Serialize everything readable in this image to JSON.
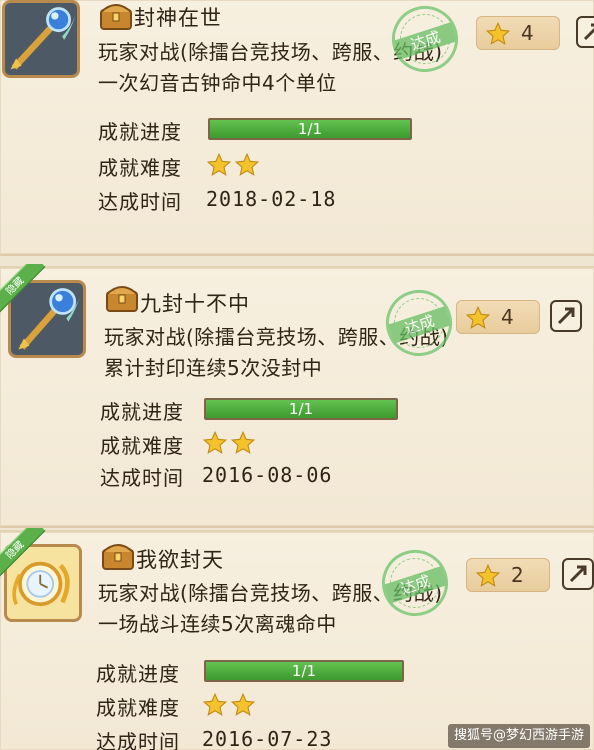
{
  "achievements": [
    {
      "ribbon": "",
      "title": "封神在世",
      "description": "玩家对战(除擂台竞技场、跨服、约战)一次幻音古钟命中4个单位",
      "stamp": "达成",
      "stars": "4",
      "progress_label": "成就进度",
      "progress_text": "1/1",
      "progress_fraction": 1.0,
      "difficulty_label": "成就难度",
      "difficulty_stars": 2,
      "date_label": "达成时间",
      "date": "2018-02-18",
      "badge_icon": "magic-staff-icon"
    },
    {
      "ribbon": "隐藏",
      "title": "九封十不中",
      "description": "玩家对战(除擂台竞技场、跨服、约战)累计封印连续5次没封中",
      "stamp": "达成",
      "stars": "4",
      "progress_label": "成就进度",
      "progress_text": "1/1",
      "progress_fraction": 1.0,
      "difficulty_label": "成就难度",
      "difficulty_stars": 2,
      "date_label": "达成时间",
      "date": "2016-08-06",
      "badge_icon": "magic-staff-icon"
    },
    {
      "ribbon": "隐藏",
      "title": "我欲封天",
      "description": "玩家对战(除擂台竞技场、跨服、约战)一场战斗连续5次离魂命中",
      "stamp": "达成",
      "stars": "2",
      "progress_label": "成就进度",
      "progress_text": "1/1",
      "progress_fraction": 1.0,
      "difficulty_label": "成就难度",
      "difficulty_stars": 2,
      "date_label": "达成时间",
      "date": "2016-07-23",
      "badge_icon": "golden-clock-icon"
    }
  ],
  "watermark": "搜狐号@梦幻西游手游",
  "colors": {
    "background": "#efe6d2",
    "progress_fill": "#4fae3d",
    "stamp_green": "#6cc36a",
    "star_gold": "#f4c22c"
  }
}
